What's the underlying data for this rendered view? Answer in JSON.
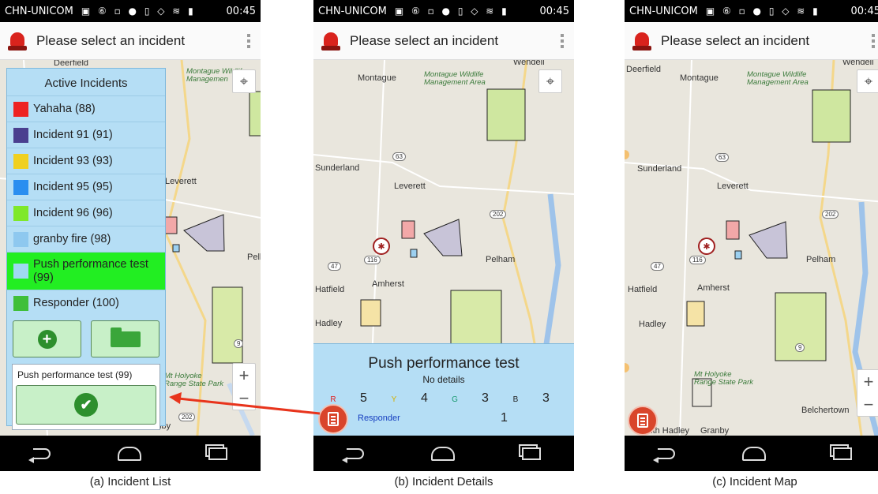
{
  "status_bar": {
    "carrier": "CHN-UNICOM",
    "time": "00:45",
    "icons": "▣ ⑥ ▫ ● ▯ ◇ ≋ ▮"
  },
  "action_bar": {
    "title": "Please select an incident"
  },
  "map_labels": {
    "deerfield": "Deerfield",
    "montague": "Montague",
    "wendell": "Wendell",
    "wildlife_1": "Montague Wildlife",
    "wildlife_2": "Management Area",
    "wildlife_short": "Managemen",
    "sunderland": "Sunderland",
    "leverett": "Leverett",
    "pelham": "Pelham",
    "amherst": "Amherst",
    "hatfield": "Hatfield",
    "hadley": "Hadley",
    "south_hadley": "South Hadley",
    "granby": "Granby",
    "belchertown": "Belchertown",
    "holyoke_1": "Mt Holyoke",
    "holyoke_2": "Range State Park",
    "route_63": "63",
    "route_202": "202",
    "route_47": "47",
    "route_116": "116",
    "route_9": "9"
  },
  "incident_list": {
    "title": "Active Incidents",
    "items": [
      {
        "label": "Yahaha (88)",
        "color": "#ee2222"
      },
      {
        "label": "Incident 91 (91)",
        "color": "#4a3f8f"
      },
      {
        "label": "Incident 93 (93)",
        "color": "#f0d020"
      },
      {
        "label": "Incident 95 (95)",
        "color": "#2a8ef0"
      },
      {
        "label": "Incident 96 (96)",
        "color": "#7fe82a"
      },
      {
        "label": "granby fire (98)",
        "color": "#8ec8ef"
      },
      {
        "label": "Push performance test (99)",
        "color": "#9fd9f2",
        "selected": true
      },
      {
        "label": "Responder (100)",
        "color": "#3fbf3a"
      }
    ],
    "selected_text": "Push performance test  (99)"
  },
  "details": {
    "title": "Push performance test",
    "subtitle": "No details",
    "counts": [
      {
        "label": "R",
        "value": "5",
        "color": "#e02020"
      },
      {
        "label": "Y",
        "value": "4",
        "color": "#d4b000"
      },
      {
        "label": "G",
        "value": "3",
        "color": "#1a9a70"
      },
      {
        "label": "B",
        "value": "3",
        "color": "#222222"
      }
    ],
    "responder_label": "Responder",
    "responder_value": "1"
  },
  "captions": {
    "a": "(a) Incident List",
    "b": "(b) Incident Details",
    "c": "(c) Incident Map"
  }
}
